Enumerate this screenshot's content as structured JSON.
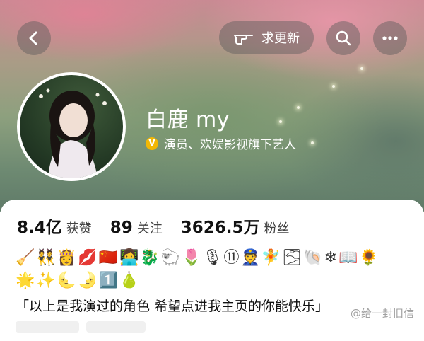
{
  "header": {
    "refresh_label": "求更新",
    "icons": {
      "back": "back-arrow-icon",
      "hand": "pointing-hand-icon",
      "search": "search-icon",
      "more": "more-dots-icon"
    }
  },
  "profile": {
    "name": "白鹿 my",
    "verify_badge": "V",
    "verify_text": "演员、欢娱影视旗下艺人"
  },
  "stats": [
    {
      "value": "8.4亿",
      "label": "获赞"
    },
    {
      "value": "89",
      "label": "关注"
    },
    {
      "value": "3626.5万",
      "label": "粉丝"
    }
  ],
  "emoji_line_1": "🧹👯👸💋🇨🇳👩‍💻🐉🐑🌷🎙⑪👮🧚🌫🐚❄📖🌻",
  "emoji_line_2": "🌟✨🌜🌛1️⃣🍐",
  "bio": "「以上是我演过的角色 希望点进我主页的你能快乐」",
  "watermark": "@给一封旧信",
  "colors": {
    "accent_gold": "#f2b705",
    "text_dark": "#111111",
    "header_top": "#c98a93",
    "header_bottom": "#5f7a68"
  }
}
